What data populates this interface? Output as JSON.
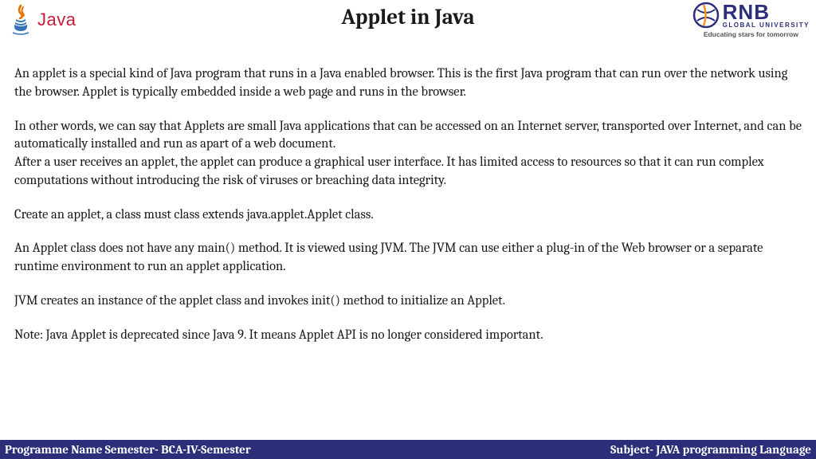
{
  "header": {
    "java_logo_text": "Java",
    "title": "Applet in Java",
    "rnb": {
      "name": "RNB",
      "sub": "GLOBAL UNIVERSITY",
      "tagline": "Educating stars for tomorrow"
    }
  },
  "content": {
    "p1": "An applet is a special kind of Java program that runs in a Java enabled browser. This is the first Java program that can run over the network using the browser. Applet is typically embedded inside a web page and runs in the browser.",
    "p2": "In other words, we can say that Applets are small Java applications that can be accessed on an Internet server, transported over Internet, and can be automatically installed and run as apart of a web document.",
    "p3": "After a user receives an applet, the applet can produce a graphical user interface. It has limited access to resources so that it can run complex computations without introducing the risk of viruses or breaching data integrity.",
    "p4": "Create an applet, a class must class extends java.applet.Applet class.",
    "p5": "An Applet class does not have any main() method. It is viewed using JVM. The JVM can use either a plug-in of the Web browser or a separate runtime environment to run an applet application.",
    "p6": "JVM creates an instance of the applet class and invokes init() method to initialize an Applet.",
    "p7": "Note: Java Applet is deprecated since Java 9. It means Applet API is no longer considered important."
  },
  "footer": {
    "left": "Programme Name Semester- BCA-IV-Semester",
    "right": "Subject- JAVA programming Language"
  }
}
